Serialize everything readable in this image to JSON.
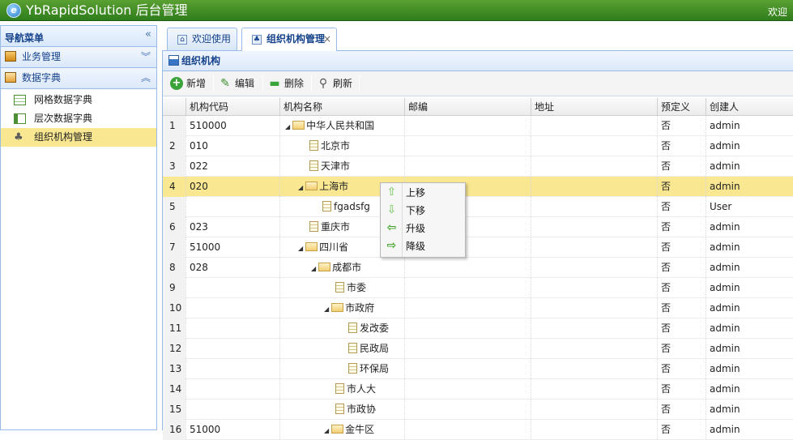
{
  "app": {
    "logo_letter": "e",
    "title": "YbRapidSolution 后台管理",
    "welcome": "欢迎"
  },
  "sidebar": {
    "header": "导航菜单",
    "header_icon": "double-chevron-left-icon",
    "sections": [
      {
        "label": "业务管理",
        "expanded": false
      },
      {
        "label": "数据字典",
        "expanded": true
      }
    ],
    "items": [
      {
        "label": "网格数据字典"
      },
      {
        "label": "层次数据字典"
      },
      {
        "label": "组织机构管理",
        "selected": true
      }
    ]
  },
  "tabs": [
    {
      "label": "欢迎使用"
    },
    {
      "label": "组织机构管理",
      "active": true,
      "close": "×"
    }
  ],
  "panel": {
    "title": "组织机构"
  },
  "toolbar": {
    "add": "新增",
    "edit": "编辑",
    "delete": "删除",
    "refresh": "刷新"
  },
  "grid": {
    "columns": [
      "机构代码",
      "机构名称",
      "邮编",
      "地址",
      "预定义",
      "创建人"
    ],
    "rows": [
      {
        "n": "1",
        "code": "510000",
        "name": "中华人民共和国",
        "predef": "否",
        "creator": "admin",
        "level": 0,
        "folder": true
      },
      {
        "n": "2",
        "code": "010",
        "name": "北京市",
        "predef": "否",
        "creator": "admin",
        "level": 1,
        "folder": false
      },
      {
        "n": "3",
        "code": "022",
        "name": "天津市",
        "predef": "否",
        "creator": "admin",
        "level": 1,
        "folder": false
      },
      {
        "n": "4",
        "code": "020",
        "name": "上海市",
        "predef": "否",
        "creator": "admin",
        "level": 1,
        "folder": true,
        "highlighted": true
      },
      {
        "n": "5",
        "code": "",
        "name": "fgadsfg",
        "predef": "否",
        "creator": "User",
        "level": 2,
        "folder": false
      },
      {
        "n": "6",
        "code": "023",
        "name": "重庆市",
        "predef": "否",
        "creator": "admin",
        "level": 1,
        "folder": false
      },
      {
        "n": "7",
        "code": "51000",
        "name": "四川省",
        "predef": "否",
        "creator": "admin",
        "level": 1,
        "folder": true
      },
      {
        "n": "8",
        "code": "028",
        "name": "成都市",
        "predef": "否",
        "creator": "admin",
        "level": 2,
        "folder": true
      },
      {
        "n": "9",
        "code": "",
        "name": "市委",
        "predef": "否",
        "creator": "admin",
        "level": 3,
        "folder": false
      },
      {
        "n": "10",
        "code": "",
        "name": "市政府",
        "predef": "否",
        "creator": "admin",
        "level": 3,
        "folder": true
      },
      {
        "n": "11",
        "code": "",
        "name": "发改委",
        "predef": "否",
        "creator": "admin",
        "level": 4,
        "folder": false
      },
      {
        "n": "12",
        "code": "",
        "name": "民政局",
        "predef": "否",
        "creator": "admin",
        "level": 4,
        "folder": false
      },
      {
        "n": "13",
        "code": "",
        "name": "环保局",
        "predef": "否",
        "creator": "admin",
        "level": 4,
        "folder": false
      },
      {
        "n": "14",
        "code": "",
        "name": "市人大",
        "predef": "否",
        "creator": "admin",
        "level": 3,
        "folder": false
      },
      {
        "n": "15",
        "code": "",
        "name": "市政协",
        "predef": "否",
        "creator": "admin",
        "level": 3,
        "folder": false
      },
      {
        "n": "16",
        "code": "51000",
        "name": "金牛区",
        "predef": "否",
        "creator": "admin",
        "level": 3,
        "folder": true
      }
    ]
  },
  "context_menu": {
    "items": [
      {
        "label": "上移",
        "icon": "arrow-up-icon"
      },
      {
        "label": "下移",
        "icon": "arrow-down-icon"
      },
      {
        "label": "升级",
        "icon": "arrow-left-icon"
      },
      {
        "label": "降级",
        "icon": "arrow-right-icon"
      }
    ]
  }
}
